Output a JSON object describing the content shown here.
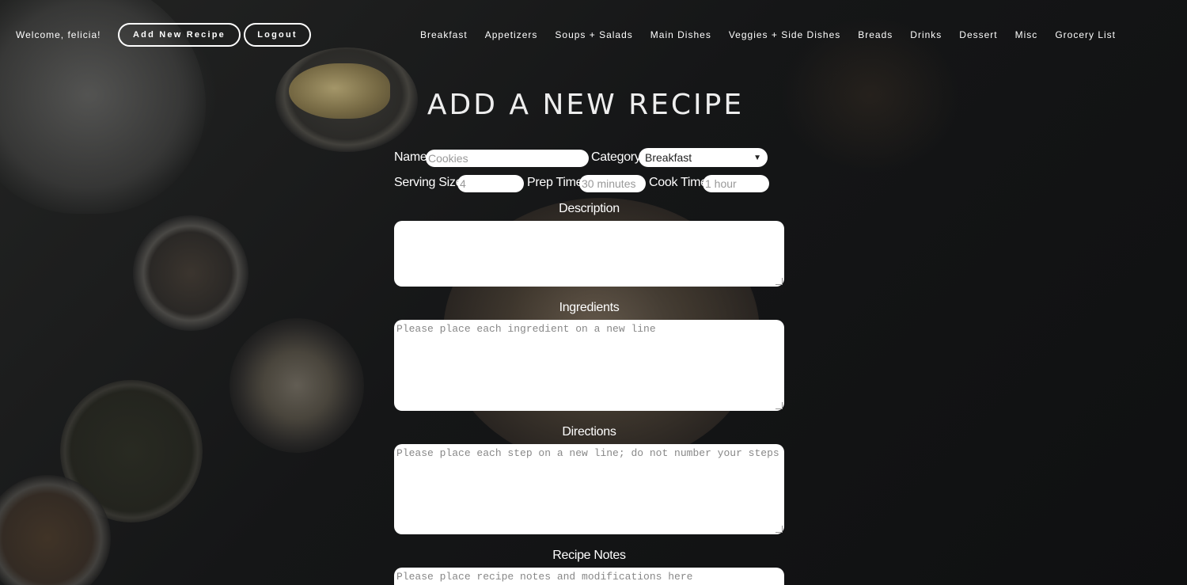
{
  "header": {
    "welcome": "Welcome, felicia!",
    "add_recipe_label": "Add New Recipe",
    "logout_label": "Logout"
  },
  "nav": {
    "items": [
      "Breakfast",
      "Appetizers",
      "Soups + Salads",
      "Main Dishes",
      "Veggies + Side Dishes",
      "Breads",
      "Drinks",
      "Dessert",
      "Misc",
      "Grocery List"
    ]
  },
  "page_title": "ADD A NEW RECIPE",
  "form": {
    "name_label": "Name",
    "name_placeholder": "Cookies",
    "category_label": "Category",
    "category_value": "Breakfast",
    "serving_label": "Serving Size",
    "serving_placeholder": "4",
    "prep_label": "Prep Time",
    "prep_placeholder": "30 minutes",
    "cook_label": "Cook Time",
    "cook_placeholder": "1 hour",
    "description_label": "Description",
    "description_placeholder": "",
    "ingredients_label": "Ingredients",
    "ingredients_placeholder": "Please place each ingredient on a new line",
    "directions_label": "Directions",
    "directions_placeholder": "Please place each step on a new line; do not number your steps",
    "notes_label": "Recipe Notes",
    "notes_placeholder": "Please place recipe notes and modifications here"
  }
}
